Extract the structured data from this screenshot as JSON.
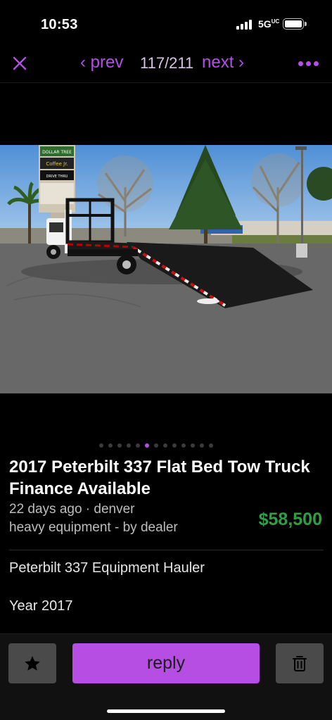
{
  "status_bar": {
    "time": "10:53",
    "network": "5G",
    "network_suffix": "UC",
    "icons": [
      "signal-icon",
      "battery-icon"
    ]
  },
  "nav": {
    "close_icon": "close-icon",
    "prev_label": "‹ prev",
    "counter": "117/211",
    "next_label": "next ›",
    "more_icon": "more-icon"
  },
  "photo": {
    "sign_lines": [
      "DOLLAR TREE",
      "Coffee Jr.",
      "DRIVE THRU"
    ]
  },
  "gallery": {
    "total_dots": 13,
    "active_index": 5
  },
  "listing": {
    "title": "2017 Peterbilt 337 Flat Bed Tow Truck Finance Available",
    "posted": "22 days ago · denver",
    "category": "heavy equipment - by dealer",
    "price": "$58,500",
    "description": [
      "Peterbilt 337 Equipment Hauler",
      "Year 2017"
    ]
  },
  "actions": {
    "favorite_icon": "star-icon",
    "reply_label": "reply",
    "delete_icon": "trash-icon"
  },
  "colors": {
    "accent": "#b44fe6",
    "price": "#2ea043",
    "background": "#000000",
    "button_gray": "#4a4a4a"
  }
}
